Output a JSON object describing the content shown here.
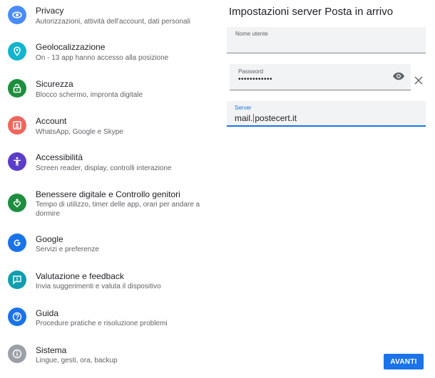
{
  "settings": {
    "items": [
      {
        "title": "Privacy",
        "subtitle": "Autorizzazioni, attività dell'account, dati personali",
        "icon": "privacy-eye-icon",
        "color": "#4a8cf7"
      },
      {
        "title": "Geolocalizzazione",
        "subtitle": "On - 13 app hanno accesso alla posizione",
        "icon": "location-pin-icon",
        "color": "#12b5cb"
      },
      {
        "title": "Sicurezza",
        "subtitle": "Blocco schermo, impronta digitale",
        "icon": "lock-open-icon",
        "color": "#1e8e3e"
      },
      {
        "title": "Account",
        "subtitle": "WhatsApp, Google e Skype",
        "icon": "account-box-icon",
        "color": "#ee675c"
      },
      {
        "title": "Accessibilità",
        "subtitle": "Screen reader, display, controlli interazione",
        "icon": "accessibility-icon",
        "color": "#5b3dc8"
      },
      {
        "title": "Benessere digitale e Controllo genitori",
        "subtitle": "Tempo di utilizzo, timer delle app, orari per andare a dormire",
        "icon": "wellbeing-heart-icon",
        "color": "#1e8e3e"
      },
      {
        "title": "Google",
        "subtitle": "Servizi e preferenze",
        "icon": "google-g-icon",
        "color": "#1a73e8"
      },
      {
        "title": "Valutazione e feedback",
        "subtitle": "Invia suggerimenti e valuta il dispositivo",
        "icon": "feedback-icon",
        "color": "#129eaf"
      },
      {
        "title": "Guida",
        "subtitle": "Procedure pratiche e risoluzione problemi",
        "icon": "help-icon",
        "color": "#1a73e8"
      },
      {
        "title": "Sistema",
        "subtitle": "Lingue, gesti, ora, backup",
        "icon": "info-icon",
        "color": "#9aa0a6"
      }
    ]
  },
  "server_setup": {
    "title": "Impostazioni server Posta in arrivo",
    "username": {
      "label": "Nome utente",
      "value": ""
    },
    "password": {
      "label": "Password",
      "value": "••••••••••••"
    },
    "server": {
      "label": "Server",
      "value_before_cursor": "mail.",
      "value_after_cursor": "postecert.it"
    },
    "next_label": "AVANTI"
  },
  "colors": {
    "accent": "#1a73e8"
  }
}
